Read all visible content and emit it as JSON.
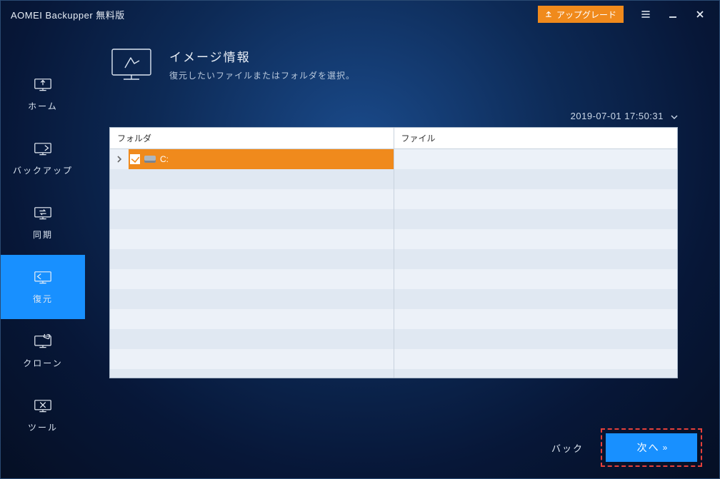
{
  "titlebar": {
    "title": "AOMEI Backupper 無料版",
    "upgrade_label": "アップグレード"
  },
  "sidebar": {
    "items": [
      {
        "label": "ホーム",
        "icon": "home-icon"
      },
      {
        "label": "バックアップ",
        "icon": "backup-icon"
      },
      {
        "label": "同期",
        "icon": "sync-icon"
      },
      {
        "label": "復元",
        "icon": "restore-icon"
      },
      {
        "label": "クローン",
        "icon": "clone-icon"
      },
      {
        "label": "ツール",
        "icon": "tools-icon"
      }
    ],
    "active_index": 3
  },
  "header": {
    "title": "イメージ情報",
    "subtitle": "復元したいファイルまたはフォルダを選択。"
  },
  "timestamp": "2019-07-01 17:50:31",
  "panel": {
    "folder_header": "フォルダ",
    "file_header": "ファイル",
    "folders": [
      {
        "drive": "C:",
        "selected": true,
        "checked": true
      }
    ]
  },
  "footer": {
    "back_label": "バック",
    "next_label": "次へ"
  }
}
